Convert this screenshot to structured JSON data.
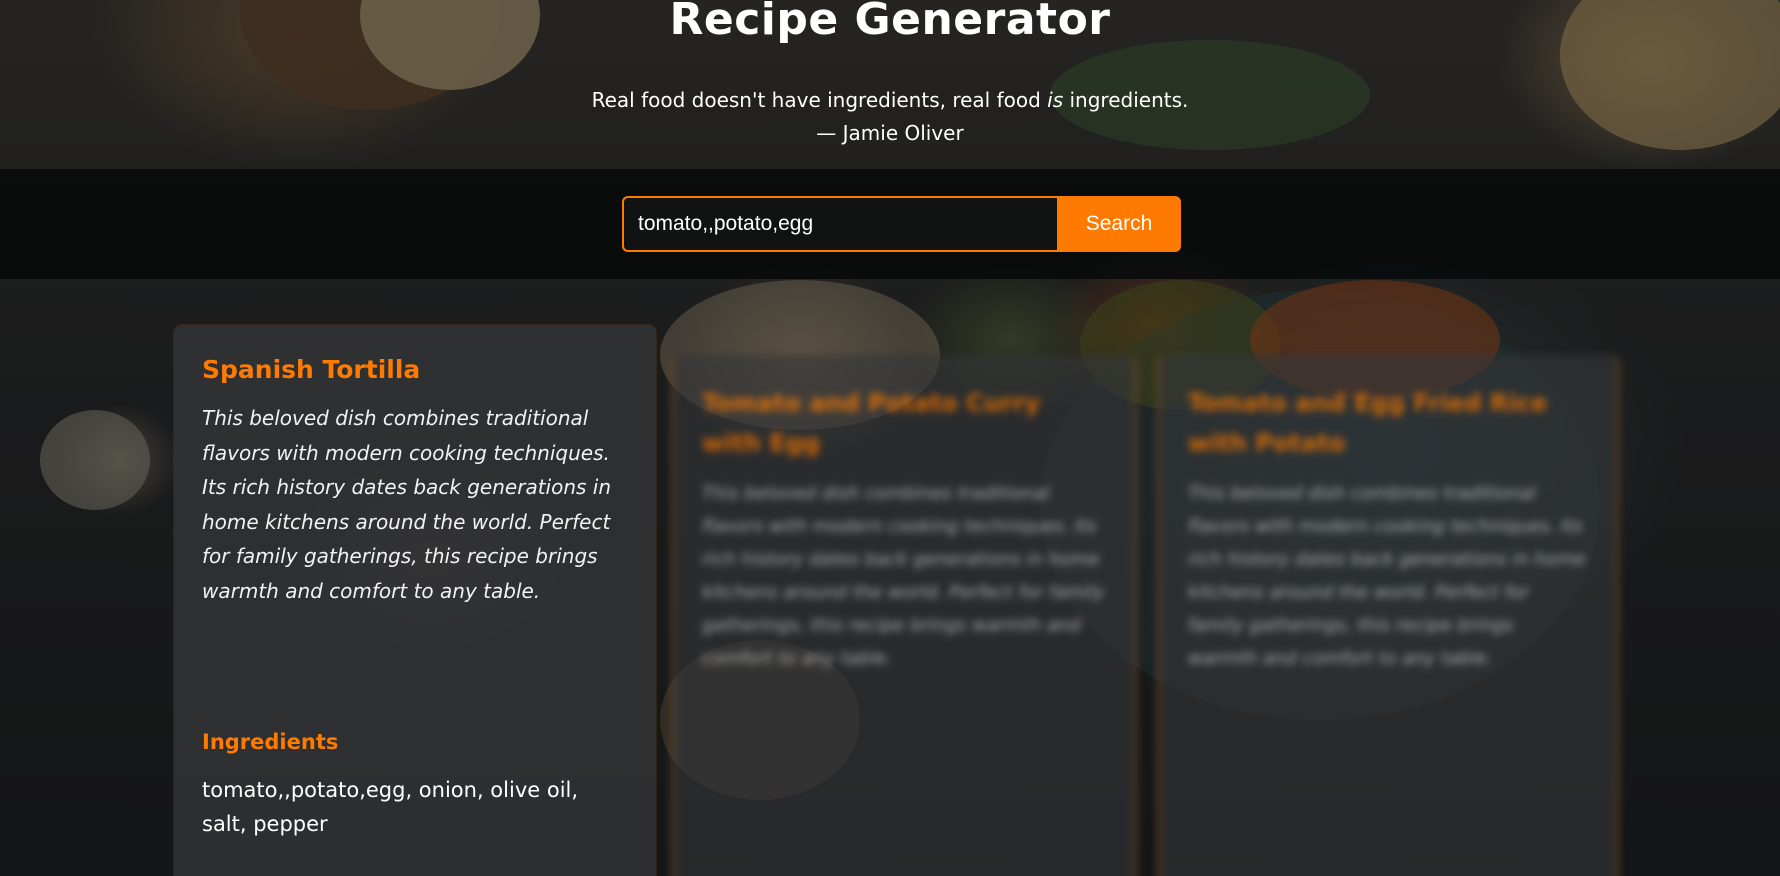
{
  "header": {
    "title": "Recipe Generator",
    "quote_pre": "Real food doesn't have ingredients, real food ",
    "quote_em": "is",
    "quote_post": " ingredients.",
    "quote_author": "— Jamie Oliver"
  },
  "search": {
    "value": "tomato,,potato,egg",
    "button_label": "Search"
  },
  "cards": [
    {
      "title": "Spanish Tortilla",
      "description": "This beloved dish combines traditional flavors with modern cooking techniques. Its rich history dates back generations in home kitchens around the world. Perfect for family gatherings, this recipe brings warmth and comfort to any table.",
      "ingredients_heading": "Ingredients",
      "ingredients": "tomato,,potato,egg, onion, olive oil, salt, pepper"
    },
    {
      "title": "Tomato and Potato Curry with Egg",
      "description": "This beloved dish combines traditional flavors with modern cooking techniques. Its rich history dates back generations in home kitchens around the world. Perfect for family gatherings, this recipe brings warmth and comfort to any table."
    },
    {
      "title": "Tomato and Egg Fried Rice with Potato",
      "description": "This beloved dish combines traditional flavors with modern cooking techniques. Its rich history dates back generations in home kitchens around the world. Perfect for family gatherings, this recipe brings warmth and comfort to any table."
    }
  ],
  "colors": {
    "accent": "#ff7a00",
    "band": "#080a0a",
    "card": "#343638"
  }
}
